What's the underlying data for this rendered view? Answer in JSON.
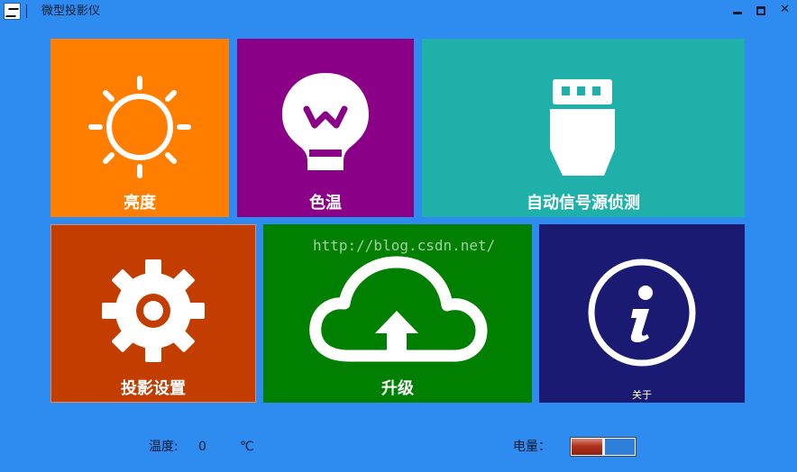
{
  "window": {
    "title": "微型投影仪"
  },
  "tiles": {
    "brightness": {
      "label": "亮度",
      "color": "#ff7e00",
      "icon": "sun-icon"
    },
    "color_temp": {
      "label": "色温",
      "color": "#8a0087",
      "icon": "lightbulb-icon"
    },
    "signal": {
      "label": "自动信号源侦测",
      "color": "#1fb1a9",
      "icon": "usb-plug-icon"
    },
    "settings": {
      "label": "投影设置",
      "color": "#c33d00",
      "icon": "gear-icon"
    },
    "upgrade": {
      "label": "升级",
      "color": "#007f00",
      "icon": "cloud-upload-icon"
    },
    "about": {
      "label": "关于",
      "color": "#1a1a72",
      "icon": "info-icon"
    }
  },
  "watermark": "http://blog.csdn.net/",
  "status": {
    "temperature_label": "温度:",
    "temperature_value": "0",
    "temperature_unit": "℃",
    "battery_label": "电量：",
    "battery_level": 0.5
  }
}
